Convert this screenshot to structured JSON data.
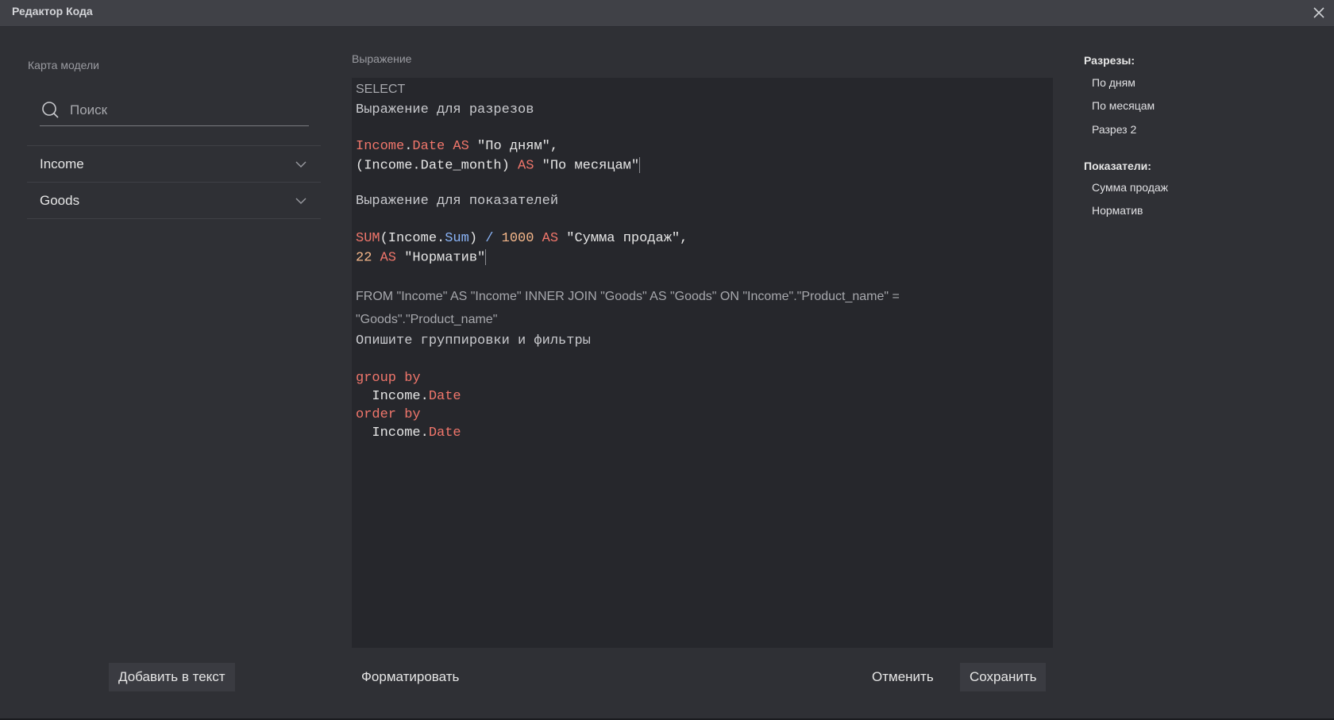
{
  "window": {
    "title": "Редактор Кода"
  },
  "model_map": {
    "label": "Карта модели",
    "search_placeholder": "Поиск",
    "items": [
      {
        "label": "Income"
      },
      {
        "label": "Goods"
      }
    ]
  },
  "expression": {
    "label": "Выражение",
    "select_kw": "SELECT",
    "dims_comment": "Выражение для разрезов",
    "line_dim1_a": "Income",
    "line_dim1_b": ".",
    "line_dim1_c": "Date",
    "line_dim1_d": " AS ",
    "line_dim1_e": "\"По дням\",",
    "line_dim2_a": "(Income.Date_month)",
    "line_dim2_b": " AS ",
    "line_dim2_c": "\"По месяцам\"",
    "meas_comment": "Выражение для показателей",
    "line_m1_a": "SUM",
    "line_m1_b": "(Income.",
    "line_m1_c": "Sum",
    "line_m1_d": ")",
    "line_m1_e": " / ",
    "line_m1_f": "1000",
    "line_m1_g": " AS ",
    "line_m1_h": "\"Сумма продаж\",",
    "line_m2_a": "22",
    "line_m2_b": " AS ",
    "line_m2_c": "\"Норматив\"",
    "from_line1": "FROM \"Income\" AS \"Income\" INNER JOIN \"Goods\" AS \"Goods\" ON \"Income\".\"Product_name\" =",
    "from_line2": "\"Goods\".\"Product_name\"",
    "group_comment": "Опишите группировки и фильтры",
    "group_by": "group by",
    "group_field_a": "  Income.",
    "group_field_b": "Date",
    "order_by": "order by",
    "order_field_a": "  Income.",
    "order_field_b": "Date"
  },
  "dimensions": {
    "title": "Разрезы:",
    "items": [
      "По дням",
      "По месяцам",
      "Разрез 2"
    ]
  },
  "measures": {
    "title": "Показатели:",
    "items": [
      "Сумма продаж",
      "Норматив"
    ]
  },
  "buttons": {
    "add_to_text": "Добавить в текст",
    "format": "Форматировать",
    "cancel": "Отменить",
    "save": "Сохранить"
  }
}
